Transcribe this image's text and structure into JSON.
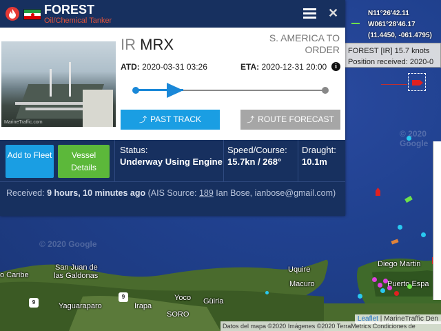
{
  "vessel": {
    "name": "FOREST",
    "type": "Oil/Chemical Tanker",
    "flag_code": "IR",
    "callsign": "MRX",
    "destination": "S. AMERICA TO ORDER",
    "atd_label": "ATD:",
    "atd_value": "2020-03-31 03:26",
    "eta_label": "ETA:",
    "eta_value": "2020-12-31 20:00",
    "photo_watermark": "MarineTraffic.com",
    "voyage_progress": 0.25
  },
  "buttons": {
    "past_track": "PAST TRACK",
    "route_forecast": "ROUTE FORECAST",
    "add_to_fleet": "Add to Fleet",
    "vessel_details": "Vessel Details"
  },
  "stats": {
    "status_label": "Status:",
    "status_value": "Underway Using Engine",
    "speed_label": "Speed/Course:",
    "speed_value": "15.7kn / 268°",
    "draught_label": "Draught:",
    "draught_value": "10.1m"
  },
  "received": {
    "prefix": "Received: ",
    "time": "9 hours, 10 minutes ago",
    "source_prefix": " (AIS Source: ",
    "source_id": "189",
    "source_suffix": " Ian Bose, ianbose@gmail.com)"
  },
  "map": {
    "coord_lat": "N11°26'42.11",
    "coord_lon": "W061°28'46.17",
    "coord_decimal": "(11.4450, -061.4795)",
    "tooltip_line1": "FOREST [IR] 15.7 knots",
    "tooltip_line2": "Position received: 2020-0",
    "google_watermark_1": "© 2020 Google",
    "google_watermark_2": "© 2020 Google",
    "places": {
      "caribe": "o Caribe",
      "san_juan": "San Juan de",
      "galdonas": "las Galdonas",
      "uquire": "Uquire",
      "macuro": "Macuro",
      "diego_martin": "Diego Martin",
      "puerto_espana": "Puerto Espa",
      "yaguaraparo": "Yaguaraparo",
      "irapa": "Irapa",
      "yoco": "Yoco",
      "guiria": "Güiria",
      "soro": "SORO",
      "route_9a": "9",
      "route_9b": "9"
    },
    "attribution_leaflet": "Leaflet",
    "attribution_rest": " | MarineTraffic Den",
    "copyright": "Datos del mapa ©2020 Imágenes ©2020 TerraMetrics   Condiciones de",
    "colors": {
      "sea": "#20418f",
      "panel_header": "#17305f",
      "accent_blue": "#1a9ee3",
      "accent_green": "#5cb83a",
      "ship_red": "#e02020",
      "type_orange": "#e0533a"
    }
  }
}
